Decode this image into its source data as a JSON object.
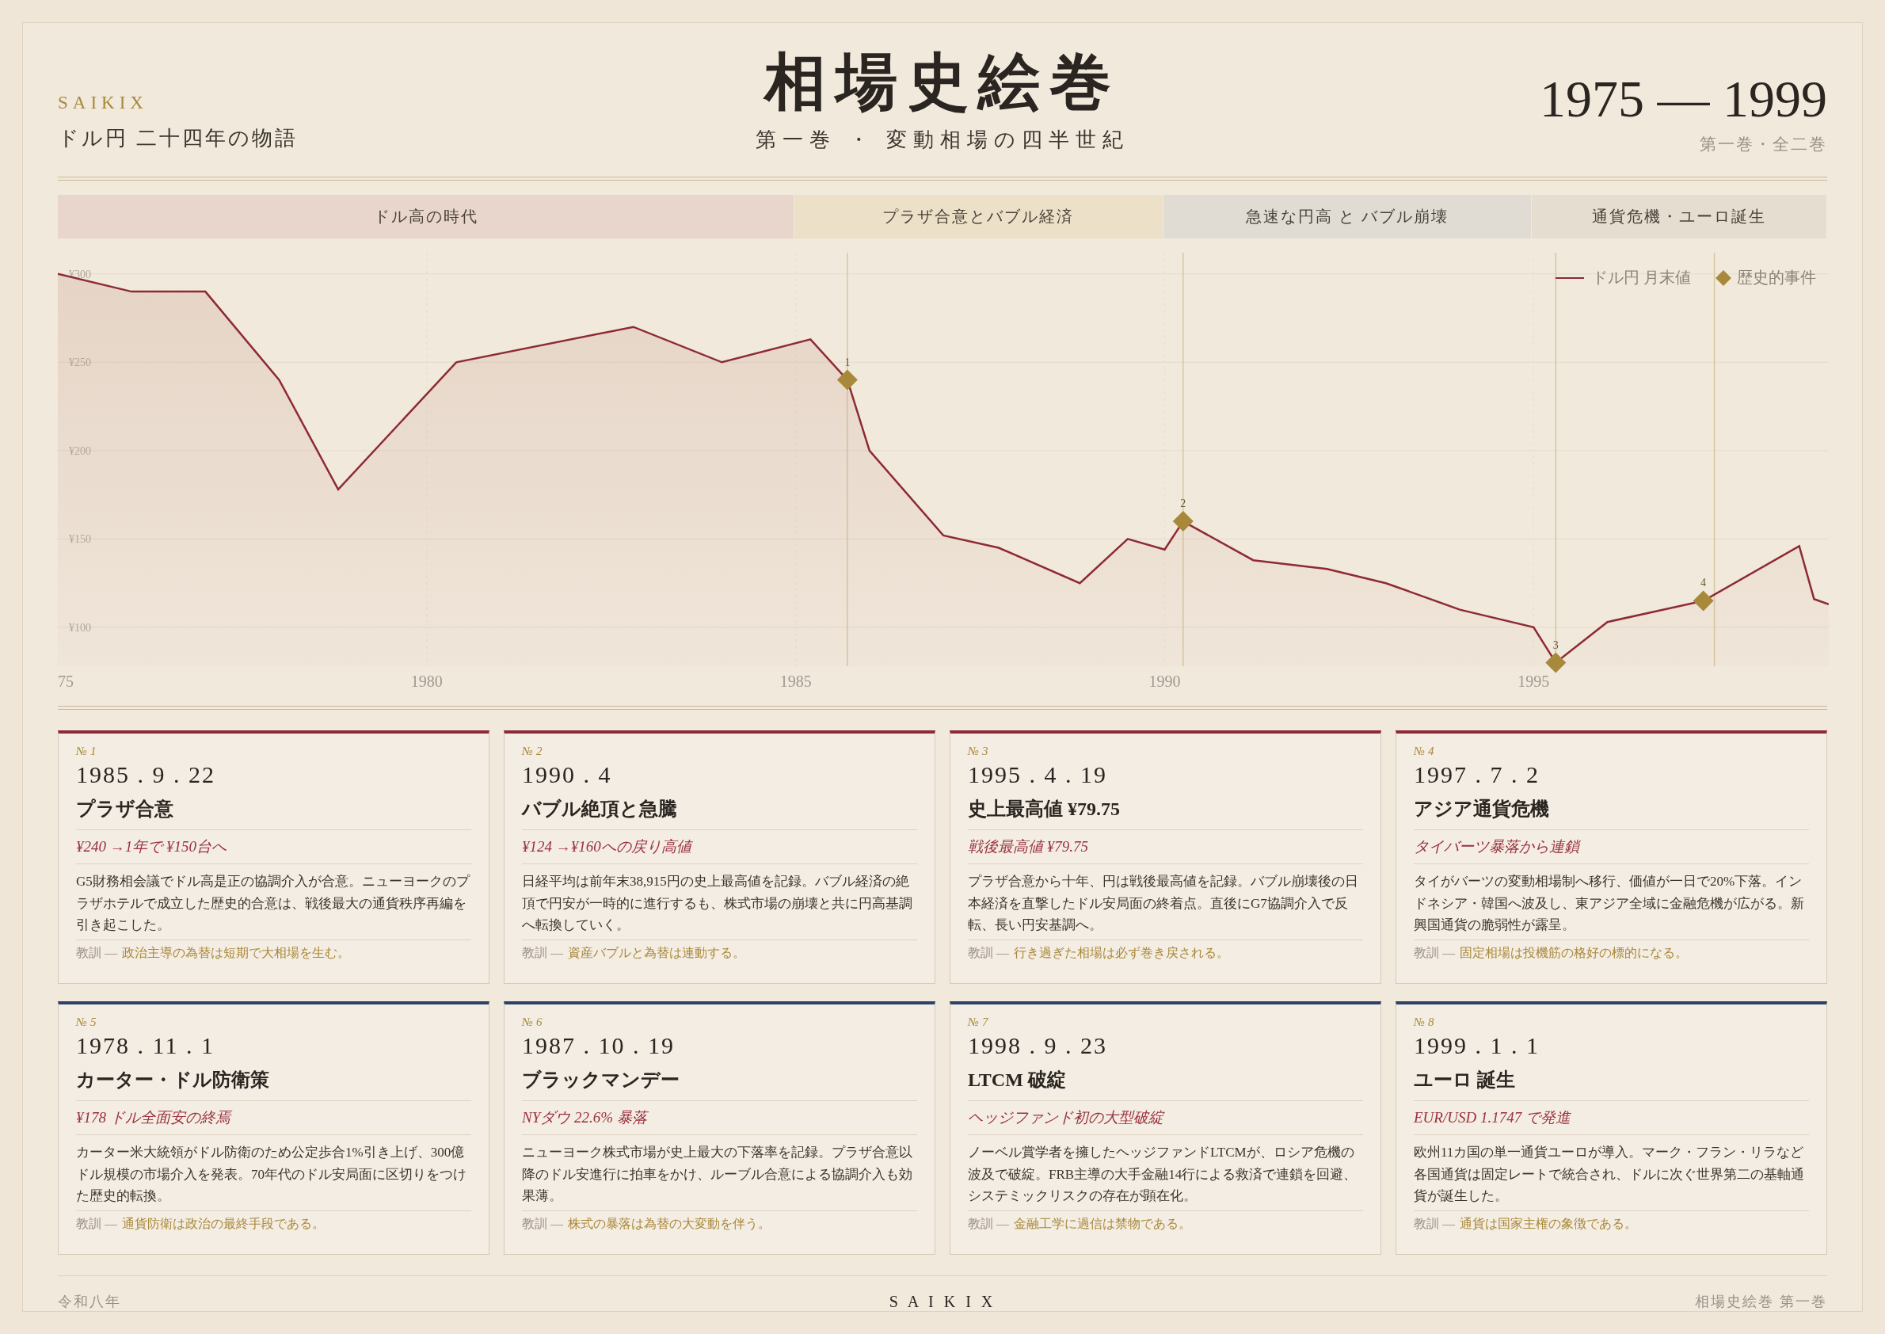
{
  "header": {
    "brand": "SAIKIX",
    "tagline": "ドル円 二十四年の物語",
    "title": "相場史絵巻",
    "subtitle": "第一巻 ・ 変動相場の四半世紀",
    "years": "1975 — 1999",
    "volume": "第一巻・全二巻"
  },
  "eras": [
    {
      "label": "ドル高の時代",
      "color": "#e8d6cc"
    },
    {
      "label": "プラザ合意とバブル経済",
      "color": "#ece0c8"
    },
    {
      "label": "急速な円高 と バブル崩壊",
      "color": "#e0dcd4"
    },
    {
      "label": "通貨危機・ユーロ誕生",
      "color": "#e4ddd0"
    }
  ],
  "chart": {
    "event_legend": "歴史的事件",
    "chart_data": {
      "type": "area",
      "x": [
        1975,
        1976,
        1977,
        1978,
        1978.8,
        1980.4,
        1982.8,
        1984,
        1985.2,
        1985.7,
        1986,
        1987,
        1987.75,
        1988.85,
        1989.5,
        1990,
        1990.25,
        1991.2,
        1992.2,
        1993,
        1994,
        1995,
        1995.3,
        1996,
        1997.3,
        1998.6,
        1998.8,
        1999
      ],
      "series": [
        {
          "name": "ドル円 月末値",
          "color": "#8e2a35",
          "values": [
            300,
            290,
            290,
            240,
            178,
            250,
            270,
            250,
            263,
            240,
            200,
            152,
            145,
            125,
            150,
            144,
            160,
            138,
            133,
            125,
            110,
            100,
            80,
            103,
            115,
            146,
            116,
            113
          ]
        }
      ],
      "xlim": [
        1975,
        1999
      ],
      "ylim": [
        78,
        312
      ],
      "grid": true,
      "xticks": [
        {
          "value": 1975,
          "label": "75"
        },
        1980,
        1985,
        1990,
        1995
      ],
      "yticks": [
        {
          "value": 100,
          "label": "¥100"
        },
        {
          "value": 150,
          "label": "¥150"
        },
        {
          "value": 200,
          "label": "¥200"
        },
        {
          "value": 250,
          "label": "¥250"
        },
        {
          "value": 300,
          "label": "¥300"
        }
      ],
      "ref_lines": [
        {
          "axis": "x",
          "value": 1985.7
        },
        {
          "axis": "x",
          "value": 1990.25
        },
        {
          "axis": "x",
          "value": 1995.3
        },
        {
          "axis": "x",
          "value": 1997.45
        }
      ],
      "annotations": [
        {
          "x": 1985.7,
          "y": 240,
          "text": "1"
        },
        {
          "x": 1990.25,
          "y": 160,
          "text": "2"
        },
        {
          "x": 1995.3,
          "y": 80,
          "text": "3"
        },
        {
          "x": 1997.3,
          "y": 115,
          "text": "4"
        }
      ]
    }
  },
  "cards": [
    {
      "no": "№ 1",
      "date": "1985 . 9 . 22",
      "title": "プラザ合意",
      "subtitle": "¥240 →1年で ¥150台へ",
      "body": "G5財務相会議でドル高是正の協調介入が合意。ニューヨークのプラザホテルで成立した歴史的合意は、戦後最大の通貨秩序再編を引き起こした。",
      "lesson_label": "教訓 —",
      "lesson": "政治主導の為替は短期で大相場を生む。",
      "color": "#8e2a35"
    },
    {
      "no": "№ 2",
      "date": "1990 . 4",
      "title": "バブル絶頂と急騰",
      "subtitle": "¥124 →¥160への戻り高値",
      "body": "日経平均は前年末38,915円の史上最高値を記録。バブル経済の絶頂で円安が一時的に進行するも、株式市場の崩壊と共に円高基調へ転換していく。",
      "lesson_label": "教訓 —",
      "lesson": "資産バブルと為替は連動する。",
      "color": "#8e2a35"
    },
    {
      "no": "№ 3",
      "date": "1995 . 4 . 19",
      "title": "史上最高値 ¥79.75",
      "subtitle": "戦後最高値 ¥79.75",
      "body": "プラザ合意から十年、円は戦後最高値を記録。バブル崩壊後の日本経済を直撃したドル安局面の終着点。直後にG7協調介入で反転、長い円安基調へ。",
      "lesson_label": "教訓 —",
      "lesson": "行き過ぎた相場は必ず巻き戻される。",
      "color": "#8e2a35"
    },
    {
      "no": "№ 4",
      "date": "1997 . 7 . 2",
      "title": "アジア通貨危機",
      "subtitle": "タイバーツ暴落から連鎖",
      "body": "タイがバーツの変動相場制へ移行、価値が一日で20%下落。インドネシア・韓国へ波及し、東アジア全域に金融危機が広がる。新興国通貨の脆弱性が露呈。",
      "lesson_label": "教訓 —",
      "lesson": "固定相場は投機筋の格好の標的になる。",
      "color": "#8e2a35"
    },
    {
      "no": "№ 5",
      "date": "1978 . 11 . 1",
      "title": "カーター・ドル防衛策",
      "subtitle": "¥178 ドル全面安の終焉",
      "body": "カーター米大統領がドル防衛のため公定歩合1%引き上げ、300億ドル規模の市場介入を発表。70年代のドル安局面に区切りをつけた歴史的転換。",
      "lesson_label": "教訓 —",
      "lesson": "通貨防衛は政治の最終手段である。",
      "color": "#2c4266"
    },
    {
      "no": "№ 6",
      "date": "1987 . 10 . 19",
      "title": "ブラックマンデー",
      "subtitle": "NYダウ 22.6% 暴落",
      "body": "ニューヨーク株式市場が史上最大の下落率を記録。プラザ合意以降のドル安進行に拍車をかけ、ルーブル合意による協調介入も効果薄。",
      "lesson_label": "教訓 —",
      "lesson": "株式の暴落は為替の大変動を伴う。",
      "color": "#2c4266"
    },
    {
      "no": "№ 7",
      "date": "1998 . 9 . 23",
      "title": "LTCM 破綻",
      "subtitle": "ヘッジファンド初の大型破綻",
      "body": "ノーベル賞学者を擁したヘッジファンドLTCMが、ロシア危機の波及で破綻。FRB主導の大手金融14行による救済で連鎖を回避、システミックリスクの存在が顕在化。",
      "lesson_label": "教訓 —",
      "lesson": "金融工学に過信は禁物である。",
      "color": "#2c4266"
    },
    {
      "no": "№ 8",
      "date": "1999 . 1 . 1",
      "title": "ユーロ 誕生",
      "subtitle": "EUR/USD 1.1747 で発進",
      "body": "欧州11カ国の単一通貨ユーロが導入。マーク・フラン・リラなど各国通貨は固定レートで統合され、ドルに次ぐ世界第二の基軸通貨が誕生した。",
      "lesson_label": "教訓 —",
      "lesson": "通貨は国家主権の象徴である。",
      "color": "#2c4266"
    }
  ],
  "footer": {
    "left": "令和八年",
    "center": "S A I K I X",
    "right": "相場史絵巻 第一巻"
  }
}
